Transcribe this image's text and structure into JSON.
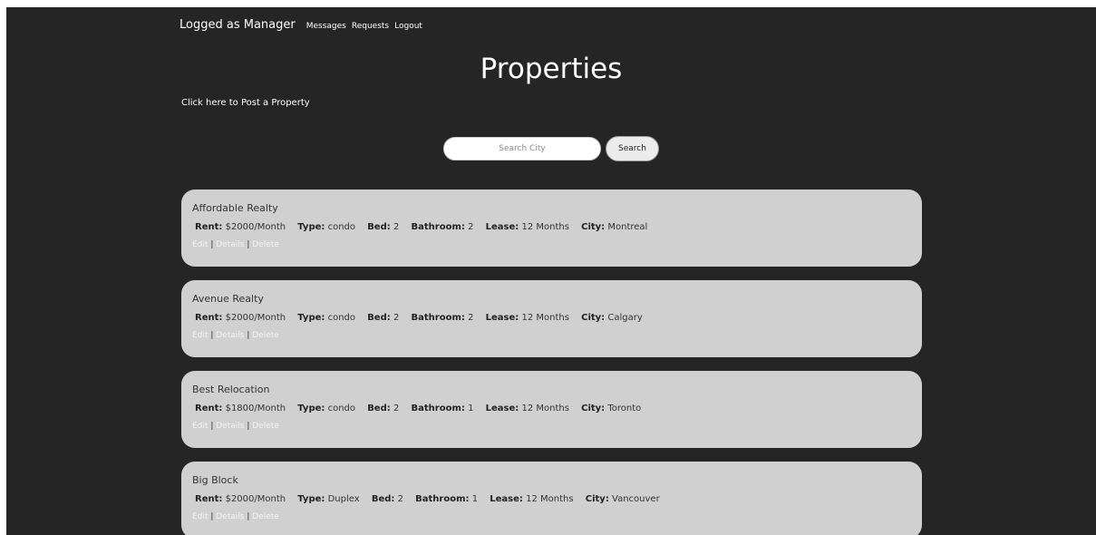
{
  "nav": {
    "brand": "Logged as Manager",
    "links": [
      "Messages",
      "Requests",
      "Logout"
    ]
  },
  "page": {
    "title": "Properties",
    "post_link": "Click here to Post a Property"
  },
  "search": {
    "placeholder": "Search City",
    "button": "Search"
  },
  "labels": {
    "rent": "Rent:",
    "type": "Type:",
    "bed": "Bed:",
    "bathroom": "Bathroom:",
    "lease": "Lease:",
    "city": "City:"
  },
  "actions": {
    "edit": "Edit",
    "details": "Details",
    "delete": "Delete",
    "separator": "|"
  },
  "properties": [
    {
      "name": "Affordable Realty",
      "rent": "$2000/Month",
      "type": "condo",
      "bed": "2",
      "bathroom": "2",
      "lease": "12 Months",
      "city": "Montreal"
    },
    {
      "name": "Avenue Realty",
      "rent": "$2000/Month",
      "type": "condo",
      "bed": "2",
      "bathroom": "2",
      "lease": "12 Months",
      "city": "Calgary"
    },
    {
      "name": "Best Relocation",
      "rent": "$1800/Month",
      "type": "condo",
      "bed": "2",
      "bathroom": "1",
      "lease": "12 Months",
      "city": "Toronto"
    },
    {
      "name": "Big Block",
      "rent": "$2000/Month",
      "type": "Duplex",
      "bed": "2",
      "bathroom": "1",
      "lease": "12 Months",
      "city": "Vancouver"
    }
  ]
}
